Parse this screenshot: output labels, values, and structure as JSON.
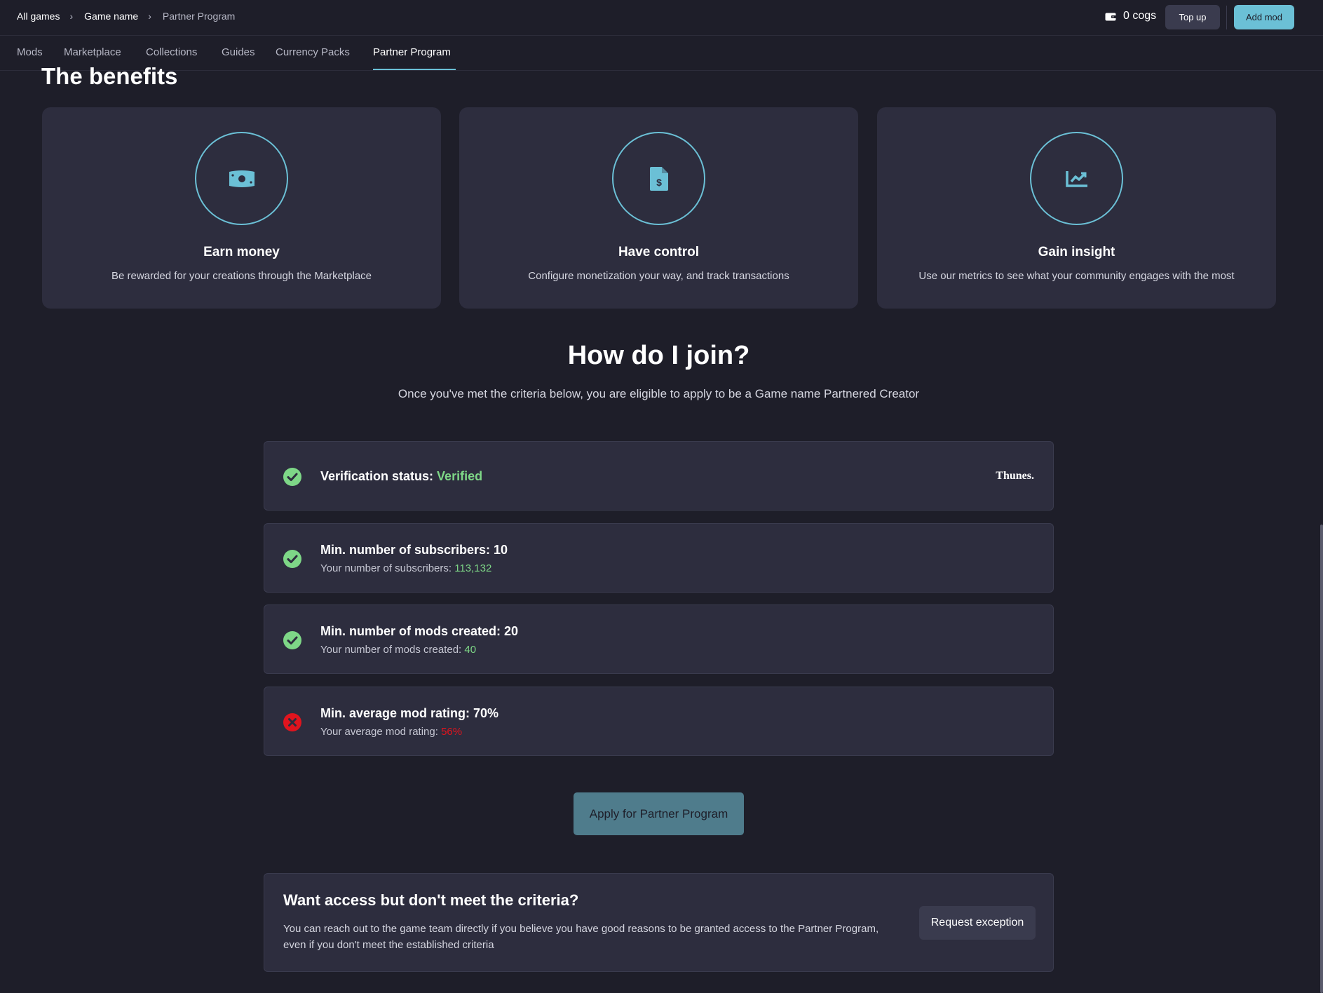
{
  "breadcrumb": [
    {
      "label": "All games"
    },
    {
      "label": "Game name"
    },
    {
      "label": "Partner Program"
    }
  ],
  "header": {
    "wallet_text": "0 cogs",
    "wallet_icon": "wallet-icon",
    "topup_label": "Top up",
    "addmod_label": "Add mod"
  },
  "tabs": [
    {
      "label": "Mods"
    },
    {
      "label": "Marketplace"
    },
    {
      "label": "Collections"
    },
    {
      "label": "Guides"
    },
    {
      "label": "Currency Packs"
    },
    {
      "label": "Partner Program",
      "active": true
    }
  ],
  "benefits": {
    "title": "The benefits",
    "cards": [
      {
        "icon": "money-icon",
        "title": "Earn money",
        "desc": "Be rewarded for your creations through the Marketplace"
      },
      {
        "icon": "document-dollar-icon",
        "title": "Have control",
        "desc": "Configure monetization your way, and track transactions"
      },
      {
        "icon": "chart-icon",
        "title": "Gain insight",
        "desc": "Use our metrics to see what your community engages with the most"
      }
    ]
  },
  "join": {
    "title": "How do I join?",
    "subtitle": "Once you've met the criteria below, you are eligible to apply to be a Game name Partnered Creator",
    "criteria": [
      {
        "status": "met",
        "main_label": "Verification status: ",
        "main_value": "Verified",
        "provider": "Thunes."
      },
      {
        "status": "met",
        "main_label": "Min. number of subscribers: 10",
        "sub_label": "Your number of subscribers: ",
        "sub_value": "113,132"
      },
      {
        "status": "met",
        "main_label": "Min. number of mods created: 20",
        "sub_label": "Your number of mods created: ",
        "sub_value": "40"
      },
      {
        "status": "unmet",
        "main_label": "Min. average mod rating: 70%",
        "sub_label": "Your average mod rating: ",
        "sub_value": "56%"
      }
    ],
    "apply_label": "Apply for Partner Program"
  },
  "exception": {
    "title": "Want access but don't meet the criteria?",
    "body": "You can reach out to the game team directly if you believe you have good reasons to be granted access to the Partner Program, even if you don't meet the established criteria",
    "button_label": "Request exception"
  },
  "colors": {
    "background": "#1e1e29",
    "card": "#2d2d3e",
    "accent": "#6bc0d6",
    "success": "#7ed787",
    "error": "#e0141e"
  }
}
